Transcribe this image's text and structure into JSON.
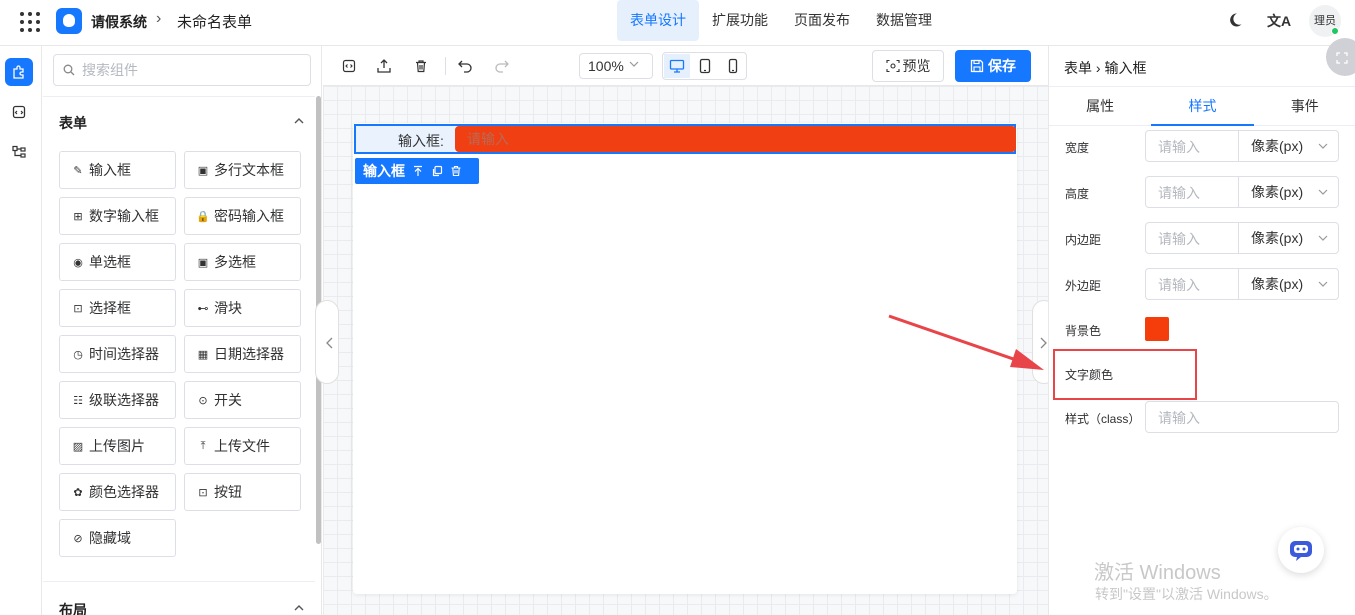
{
  "header": {
    "app_name": "请假系统",
    "separator": "›",
    "form_name": "未命名表单",
    "tabs": [
      {
        "label": "表单设计",
        "active": true
      },
      {
        "label": "扩展功能",
        "active": false
      },
      {
        "label": "页面发布",
        "active": false
      },
      {
        "label": "数据管理",
        "active": false
      }
    ],
    "translate_icon": "文A",
    "avatar_text": "理员"
  },
  "rail": {
    "items": [
      {
        "icon": "puzzle-icon",
        "active": true
      },
      {
        "icon": "code-window-icon",
        "active": false
      },
      {
        "icon": "tree-icon",
        "active": false
      }
    ]
  },
  "components": {
    "search_placeholder": "搜索组件",
    "section_form": "表单",
    "section_layout": "布局",
    "items": [
      {
        "label": "输入框",
        "icon": "pencil-icon"
      },
      {
        "label": "多行文本框",
        "icon": "textarea-icon"
      },
      {
        "label": "数字输入框",
        "icon": "number-icon"
      },
      {
        "label": "密码输入框",
        "icon": "lock-icon"
      },
      {
        "label": "单选框",
        "icon": "radio-icon"
      },
      {
        "label": "多选框",
        "icon": "checkbox-icon"
      },
      {
        "label": "选择框",
        "icon": "select-icon"
      },
      {
        "label": "滑块",
        "icon": "slider-icon"
      },
      {
        "label": "时间选择器",
        "icon": "clock-icon"
      },
      {
        "label": "日期选择器",
        "icon": "calendar-icon"
      },
      {
        "label": "级联选择器",
        "icon": "cascader-icon"
      },
      {
        "label": "开关",
        "icon": "switch-icon"
      },
      {
        "label": "上传图片",
        "icon": "image-icon"
      },
      {
        "label": "上传文件",
        "icon": "upload-icon"
      },
      {
        "label": "颜色选择器",
        "icon": "palette-icon"
      },
      {
        "label": "按钮",
        "icon": "button-icon"
      },
      {
        "label": "隐藏域",
        "icon": "eye-off-icon"
      }
    ]
  },
  "toolbar": {
    "zoom": "100%",
    "preview_label": "预览",
    "save_label": "保存"
  },
  "canvas": {
    "field_label": "输入框:",
    "field_placeholder": "请输入",
    "field_tag": "输入框",
    "field_bg_color": "#f03f13"
  },
  "properties": {
    "breadcrumb": "表单 › 输入框",
    "tabs": [
      {
        "label": "属性",
        "active": false
      },
      {
        "label": "样式",
        "active": true
      },
      {
        "label": "事件",
        "active": false
      }
    ],
    "rows": [
      {
        "label": "宽度",
        "placeholder": "请输入",
        "unit": "像素(px)"
      },
      {
        "label": "高度",
        "placeholder": "请输入",
        "unit": "像素(px)"
      },
      {
        "label": "内边距",
        "placeholder": "请输入",
        "unit": "像素(px)"
      },
      {
        "label": "外边距",
        "placeholder": "请输入",
        "unit": "像素(px)"
      }
    ],
    "bg_color_label": "背景色",
    "bg_color": "#f53d0b",
    "text_color_label": "文字颜色",
    "text_color": "#ffffff",
    "class_label": "样式（class）",
    "class_placeholder": "请输入"
  },
  "watermark": {
    "line1": "激活 Windows",
    "line2": "转到\"设置\"以激活 Windows。"
  },
  "colors": {
    "accent": "#1677ff",
    "annotation_red": "#e8454a"
  }
}
